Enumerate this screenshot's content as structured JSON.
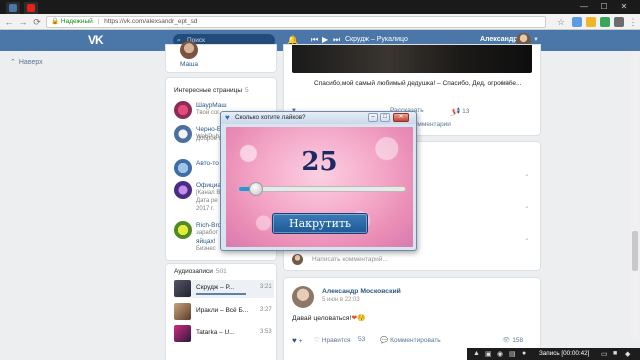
{
  "browser": {
    "window_controls": [
      "—",
      "☐",
      "✕"
    ],
    "secure_label": "Надежный",
    "url": "https://vk.com/alexsandr_ept_sd"
  },
  "vk_header": {
    "logo": "VK",
    "search_placeholder": "Поиск",
    "now_playing": "Скрудж – Рукалицо",
    "user_name": "Александр"
  },
  "left_nav": {
    "back_label": "Наверх"
  },
  "friends": {
    "name": "Маша"
  },
  "pages": {
    "title": "Интересные страницы",
    "count": "5",
    "items": [
      {
        "name": "ШаурМаш",
        "desc": "Твой сог..."
      },
      {
        "name": "Черно-Бе",
        "desc": "WebPub"
      },
      {
        "name": "Доброе п",
        "desc": ""
      },
      {
        "name": "Авто-то",
        "desc": ""
      },
      {
        "name": "Официа",
        "desc": "[Канал В..."
      },
      {
        "name": "Дата ре",
        "desc": "2017 г."
      },
      {
        "name": "Rich-Bro",
        "desc": "заработ"
      },
      {
        "name": "яйцах!",
        "desc": "Бизнес"
      }
    ]
  },
  "audio": {
    "title": "Аудиозаписи",
    "count": "501",
    "tracks": [
      {
        "name": "Скрудж – Р...",
        "duration": "3:21"
      },
      {
        "name": "Иракли – Всё Б...",
        "duration": "3:27"
      },
      {
        "name": "Tatarka – U...",
        "duration": "3:53"
      }
    ]
  },
  "post1": {
    "caption": "Спасибо,мой самый любимый дедушка! – Спасибо, Дед, огромное...",
    "time": "4:15",
    "share_label": "Поделиться",
    "repost_label": "Рассказать",
    "views": "13",
    "comments_label": "Комментарии"
  },
  "comment_input": {
    "placeholder": "Написать комментарий..."
  },
  "post2": {
    "author": "Александр Московский",
    "date": "5 июн в 22:03",
    "text": "Давай целоваться!",
    "like_label": "Нравится",
    "like_count": "53",
    "comment_label": "Комментировать",
    "views": "158"
  },
  "dialog": {
    "title": "Сколько хотите лайков?",
    "value": 25,
    "slider_max": 100,
    "slider_fraction": 0.1,
    "button_label": "Накрутить",
    "minimize": "–",
    "maximize": "□",
    "close": "✕"
  },
  "taskbar": {
    "rec_label": "Запись",
    "rec_time": "[00:00:42]"
  },
  "colors": {
    "vk_blue": "#4a76a8",
    "link": "#2a5885",
    "dialog_number": "#1c2a64",
    "dialog_button": "#2a6aa7",
    "dialog_bg_pink": "#f4a8c8"
  }
}
